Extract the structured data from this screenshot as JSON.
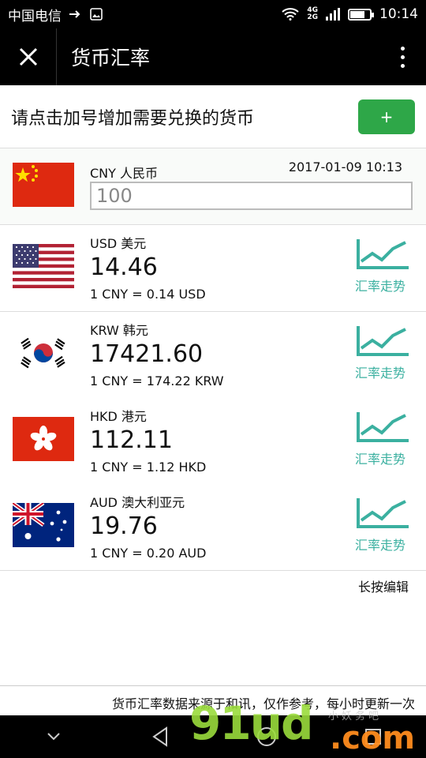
{
  "status_bar": {
    "carrier": "中国电信",
    "network_top": "4G",
    "network_bottom": "2G",
    "battery_level_pct": 75,
    "time": "10:14"
  },
  "app_bar": {
    "close_icon": "close-icon",
    "title": "货币汇率",
    "more_icon": "more-vert-icon"
  },
  "hint": {
    "text": "请点击加号增加需要兑换的货币",
    "add_label": "+",
    "add_color": "#2ea748"
  },
  "base": {
    "code": "CNY 人民币",
    "updated": "2017-01-09 10:13",
    "amount": "100"
  },
  "currencies": [
    {
      "code": "USD 美元",
      "value": "14.46",
      "rate": "1 CNY = 0.14 USD",
      "trend_label": "汇率走势"
    },
    {
      "code": "KRW 韩元",
      "value": "17421.60",
      "rate": "1 CNY = 174.22 KRW",
      "trend_label": "汇率走势"
    },
    {
      "code": "HKD 港元",
      "value": "112.11",
      "rate": "1 CNY = 1.12 HKD",
      "trend_label": "汇率走势"
    },
    {
      "code": "AUD 澳大利亚元",
      "value": "19.76",
      "rate": "1 CNY = 0.20 AUD",
      "trend_label": "汇率走势"
    }
  ],
  "edit_hint": "长按编辑",
  "footer": "货币汇率数据来源于和讯，仅作参考，每小时更新一次",
  "watermark": {
    "big": "91ud",
    "domain": ".com",
    "cn": "小妖务吧"
  },
  "colors": {
    "trend": "#3bb0a0",
    "bar": "#000000"
  }
}
